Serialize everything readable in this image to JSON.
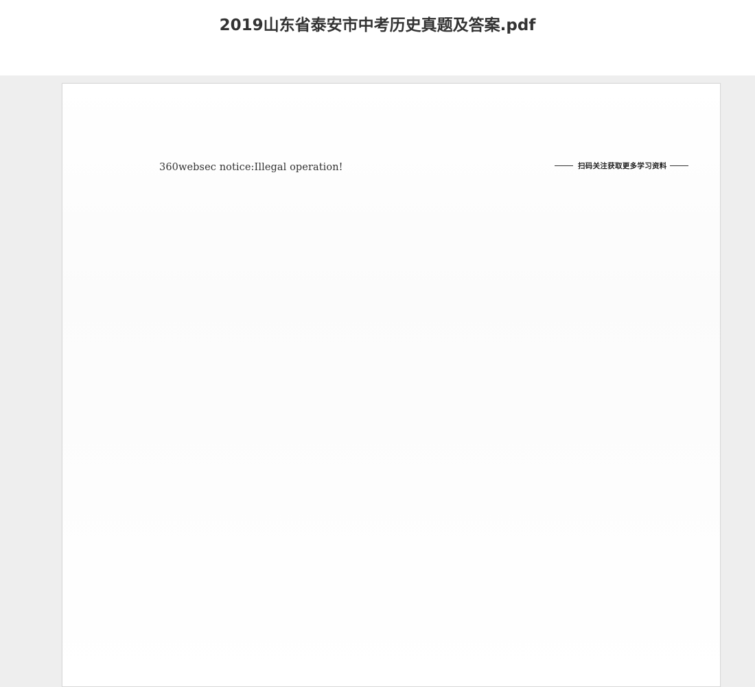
{
  "document": {
    "title": "2019山东省泰安市中考历史真题及答案.pdf"
  },
  "page": {
    "notice_text": "360websec notice:Illegal operation!",
    "header_banner_text": "扫码关注获取更多学习资料"
  }
}
